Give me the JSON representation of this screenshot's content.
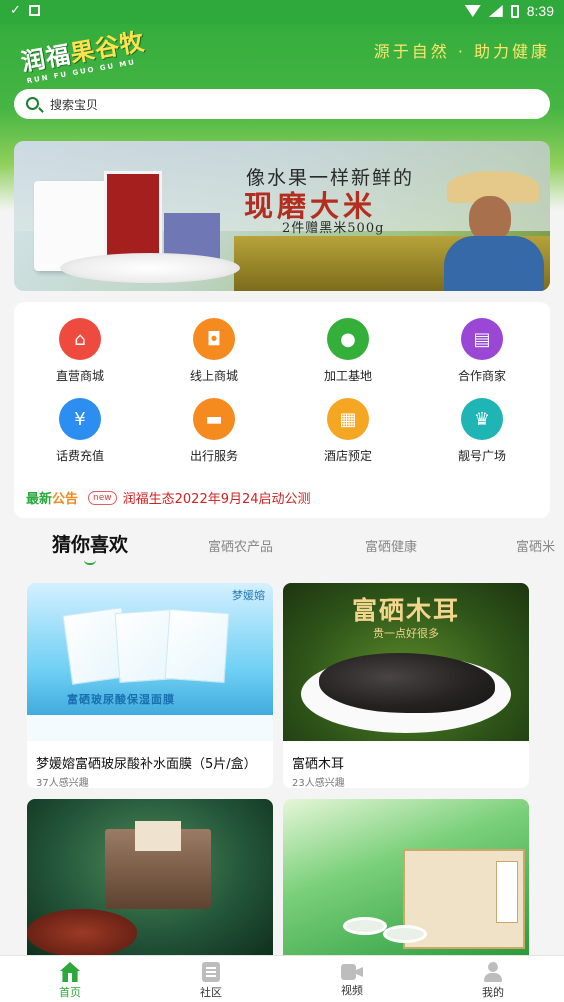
{
  "status_bar": {
    "time": "8:39"
  },
  "header": {
    "logo_text_a": "润福",
    "logo_text_b": "果谷牧",
    "logo_sub": "RUN FU GUO GU MU",
    "slogan": "源于自然 · 助力健康"
  },
  "search": {
    "placeholder": "搜索宝贝"
  },
  "banner": {
    "line1": "像水果一样新鲜的",
    "line2": "现磨大米",
    "line3": "2件赠黑米500g",
    "slides": 3,
    "active_slide": 2
  },
  "categories": [
    {
      "label": "直营商城",
      "icon": "store-icon",
      "color": "#ee4b3e"
    },
    {
      "label": "线上商城",
      "icon": "shopping-bag-icon",
      "color": "#f58a1f"
    },
    {
      "label": "加工基地",
      "icon": "egg-icon",
      "color": "#34b03a"
    },
    {
      "label": "合作商家",
      "icon": "shop-front-icon",
      "color": "#9b47d6"
    },
    {
      "label": "话费充值",
      "icon": "phone-recharge-icon",
      "color": "#2b8ef0"
    },
    {
      "label": "出行服务",
      "icon": "car-icon",
      "color": "#f58a1f"
    },
    {
      "label": "酒店预定",
      "icon": "building-icon",
      "color": "#f5a623"
    },
    {
      "label": "靓号广场",
      "icon": "basket-icon",
      "color": "#1fb5b5"
    }
  ],
  "notice": {
    "label_part1": "最新",
    "label_part2": "公告",
    "badge": "new",
    "text": "润福生态2022年9月24启动公测"
  },
  "tabs": [
    "猜你喜欢",
    "富硒农产品",
    "富硒健康",
    "富硒米"
  ],
  "products": [
    {
      "name": "梦媛嫆富硒玻尿酸补水面膜（5片/盒）",
      "interest": "37人感兴趣",
      "image_brand": "梦媛嫆",
      "image_title": "富硒玻尿酸保湿面膜"
    },
    {
      "name": "富硒木耳",
      "interest": "23人感兴趣",
      "image_title": "富硒木耳",
      "image_sub": "贵一点好很多"
    },
    {
      "name": "",
      "interest": ""
    },
    {
      "name": "",
      "interest": ""
    }
  ],
  "bottom_nav": [
    {
      "label": "首页",
      "icon": "home-icon",
      "active": true
    },
    {
      "label": "社区",
      "icon": "community-icon",
      "active": false
    },
    {
      "label": "视频",
      "icon": "video-icon",
      "active": false
    },
    {
      "label": "我的",
      "icon": "profile-icon",
      "active": false
    }
  ],
  "colors": {
    "brand_green": "#2da83a",
    "notice_orange": "#f08a1a",
    "notice_red": "#d42020",
    "slogan_yellow": "#ffe66a"
  }
}
